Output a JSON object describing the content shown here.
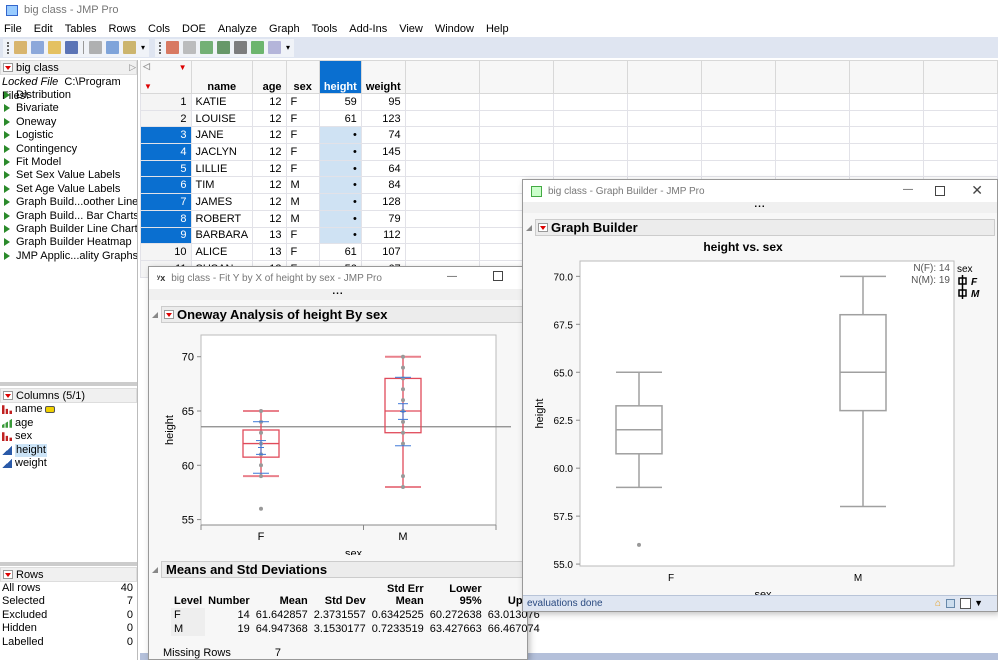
{
  "window": {
    "title": "big class - JMP Pro"
  },
  "menu": [
    "File",
    "Edit",
    "Tables",
    "Rows",
    "Cols",
    "DOE",
    "Analyze",
    "Graph",
    "Tools",
    "Add-Ins",
    "View",
    "Window",
    "Help"
  ],
  "toolbar": {
    "group1": [
      "new-data-table-icon",
      "new-script-icon",
      "open-icon",
      "save-icon",
      "cut-icon",
      "copy-icon",
      "paste-icon"
    ],
    "group2": [
      "data-table-icon",
      "tabulate-icon",
      "graph-builder-icon",
      "distribution-icon",
      "fit-y-by-x-icon",
      "fit-model-icon",
      "script-editor-icon"
    ]
  },
  "table_panel": {
    "name": "big class",
    "locked_label": "Locked File",
    "locked_path": "C:\\Program Files\\",
    "scripts": [
      "Distribution",
      "Bivariate",
      "Oneway",
      "Logistic",
      "Contingency",
      "Fit Model",
      "Set Sex Value Labels",
      "Set Age Value Labels",
      "Graph Build...oother Line",
      "Graph Build... Bar Charts",
      "Graph Builder Line Chart",
      "Graph Builder Heatmap",
      "JMP Applic...ality Graphs"
    ]
  },
  "columns_panel": {
    "header": "Columns (5/1)",
    "items": [
      {
        "name": "name",
        "type": "nominal",
        "label_icon": true
      },
      {
        "name": "age",
        "type": "ordinal"
      },
      {
        "name": "sex",
        "type": "nominal"
      },
      {
        "name": "height",
        "type": "continuous",
        "selected": true
      },
      {
        "name": "weight",
        "type": "continuous"
      }
    ]
  },
  "rows_panel": {
    "header": "Rows",
    "items": [
      {
        "label": "All rows",
        "value": "40"
      },
      {
        "label": "Selected",
        "value": "7"
      },
      {
        "label": "Excluded",
        "value": "0"
      },
      {
        "label": "Hidden",
        "value": "0"
      },
      {
        "label": "Labelled",
        "value": "0"
      }
    ]
  },
  "data_table": {
    "columns": [
      "name",
      "age",
      "sex",
      "height",
      "weight"
    ],
    "selected_column": "height",
    "rows": [
      {
        "n": "1",
        "name": "KATIE",
        "age": "12",
        "sex": "F",
        "height": "59",
        "weight": "95",
        "sel": false
      },
      {
        "n": "2",
        "name": "LOUISE",
        "age": "12",
        "sex": "F",
        "height": "61",
        "weight": "123",
        "sel": false
      },
      {
        "n": "3",
        "name": "JANE",
        "age": "12",
        "sex": "F",
        "height": "•",
        "weight": "74",
        "sel": true
      },
      {
        "n": "4",
        "name": "JACLYN",
        "age": "12",
        "sex": "F",
        "height": "•",
        "weight": "145",
        "sel": true
      },
      {
        "n": "5",
        "name": "LILLIE",
        "age": "12",
        "sex": "F",
        "height": "•",
        "weight": "64",
        "sel": true
      },
      {
        "n": "6",
        "name": "TIM",
        "age": "12",
        "sex": "M",
        "height": "•",
        "weight": "84",
        "sel": true
      },
      {
        "n": "7",
        "name": "JAMES",
        "age": "12",
        "sex": "M",
        "height": "•",
        "weight": "128",
        "sel": true
      },
      {
        "n": "8",
        "name": "ROBERT",
        "age": "12",
        "sex": "M",
        "height": "•",
        "weight": "79",
        "sel": true
      },
      {
        "n": "9",
        "name": "BARBARA",
        "age": "13",
        "sex": "F",
        "height": "•",
        "weight": "112",
        "sel": true
      },
      {
        "n": "10",
        "name": "ALICE",
        "age": "13",
        "sex": "F",
        "height": "61",
        "weight": "107",
        "sel": false
      },
      {
        "n": "11",
        "name": "SUSAN",
        "age": "13",
        "sex": "F",
        "height": "56",
        "weight": "67",
        "sel": false
      }
    ]
  },
  "oneway_window": {
    "title": "big class - Fit Y by X of height by sex - JMP Pro",
    "outline": "Oneway Analysis of height By sex",
    "means_title": "Means and Std Deviations",
    "means_headers": [
      "Level",
      "Number",
      "Mean",
      "Std Dev",
      "Std Err Mean",
      "Lower 95%",
      "Upper"
    ],
    "means_rows": [
      [
        "F",
        "14",
        "61.642857",
        "2.3731557",
        "0.6342525",
        "60.272638",
        "63.013076"
      ],
      [
        "M",
        "19",
        "64.947368",
        "3.1530177",
        "0.7233519",
        "63.427663",
        "66.467074"
      ]
    ],
    "missing_label": "Missing Rows",
    "missing_value": "7"
  },
  "graph_window": {
    "title": "big class - Graph Builder - JMP Pro",
    "outline": "Graph Builder",
    "status": "evaluations done",
    "legend_title": "sex",
    "legend": [
      "F",
      "M"
    ],
    "n_labels": [
      "N(F): 14",
      "N(M): 19"
    ]
  },
  "chart_data": [
    {
      "type": "scatter",
      "title": "Oneway Analysis of height By sex",
      "xlabel": "sex",
      "ylabel": "height",
      "categories": [
        "F",
        "M"
      ],
      "ylim": [
        54.5,
        72
      ],
      "yticks": [
        55,
        60,
        65,
        70
      ],
      "grand_mean": 63.55,
      "points": {
        "F": [
          65,
          64,
          63,
          62,
          61,
          60,
          59,
          56
        ],
        "M": [
          70,
          69,
          68,
          67,
          66,
          65,
          64,
          63,
          62,
          59,
          58
        ]
      },
      "boxes": [
        {
          "cat": "F",
          "min": 59,
          "q1": 60.75,
          "median": 62,
          "q3": 63.25,
          "max": 65
        },
        {
          "cat": "M",
          "min": 58,
          "q1": 63,
          "median": 65,
          "q3": 68,
          "max": 70
        }
      ],
      "means": [
        {
          "cat": "F",
          "mean": 61.64,
          "se": 0.634,
          "sd": 2.373
        },
        {
          "cat": "M",
          "mean": 64.95,
          "se": 0.723,
          "sd": 3.153
        }
      ],
      "colors": {
        "box": "#e04a5a",
        "mean": "#3c78d8",
        "point": "#999999",
        "grand": "#888888"
      }
    },
    {
      "type": "box",
      "title": "height vs. sex",
      "xlabel": "sex",
      "ylabel": "height",
      "categories": [
        "F",
        "M"
      ],
      "ylim": [
        54.9,
        70.8
      ],
      "yticks": [
        "55.0",
        "57.5",
        "60.0",
        "62.5",
        "65.0",
        "67.5",
        "70.0"
      ],
      "boxes": [
        {
          "cat": "F",
          "min": 59,
          "q1": 60.75,
          "median": 62,
          "q3": 63.25,
          "max": 65,
          "outliers": [
            56
          ]
        },
        {
          "cat": "M",
          "min": 58,
          "q1": 63,
          "median": 65,
          "q3": 68,
          "max": 70,
          "outliers": []
        }
      ],
      "colors": {
        "box": "#a0a0a0"
      }
    }
  ]
}
